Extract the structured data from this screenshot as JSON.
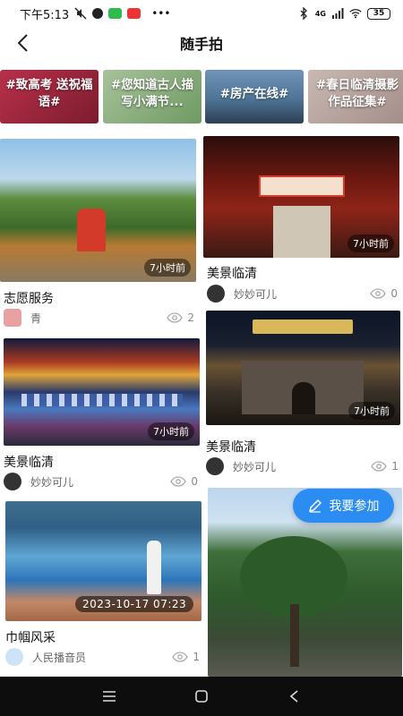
{
  "status_bar": {
    "time": "下午5:13",
    "network": "4G",
    "battery": "35"
  },
  "header": {
    "title": "随手拍"
  },
  "topics": [
    {
      "label": "#致高考 送祝福语#"
    },
    {
      "label": "#您知道古人描写小满节..."
    },
    {
      "label": "#房产在线#"
    },
    {
      "label": "#春日临清摄影作品征集#"
    }
  ],
  "posts": [
    {
      "title": "志愿服务",
      "time_label": "7小时前",
      "user": "青",
      "views": "2"
    },
    {
      "title": "美景临清",
      "time_label": "7小时前",
      "user": "妙妙可儿",
      "views": "0"
    },
    {
      "title": "美景临清",
      "time_label": "7小时前",
      "user": "妙妙可儿",
      "views": "0"
    },
    {
      "title": "美景临清",
      "time_label": "7小时前",
      "user": "妙妙可儿",
      "views": "1"
    },
    {
      "title": "巾帼风采",
      "date_label": "2023-10-17 07:23",
      "user": "人民播音员",
      "views": "1"
    },
    {
      "title": ""
    }
  ],
  "fab": {
    "label": "我要参加"
  },
  "colors": {
    "accent": "#2b8df2"
  }
}
